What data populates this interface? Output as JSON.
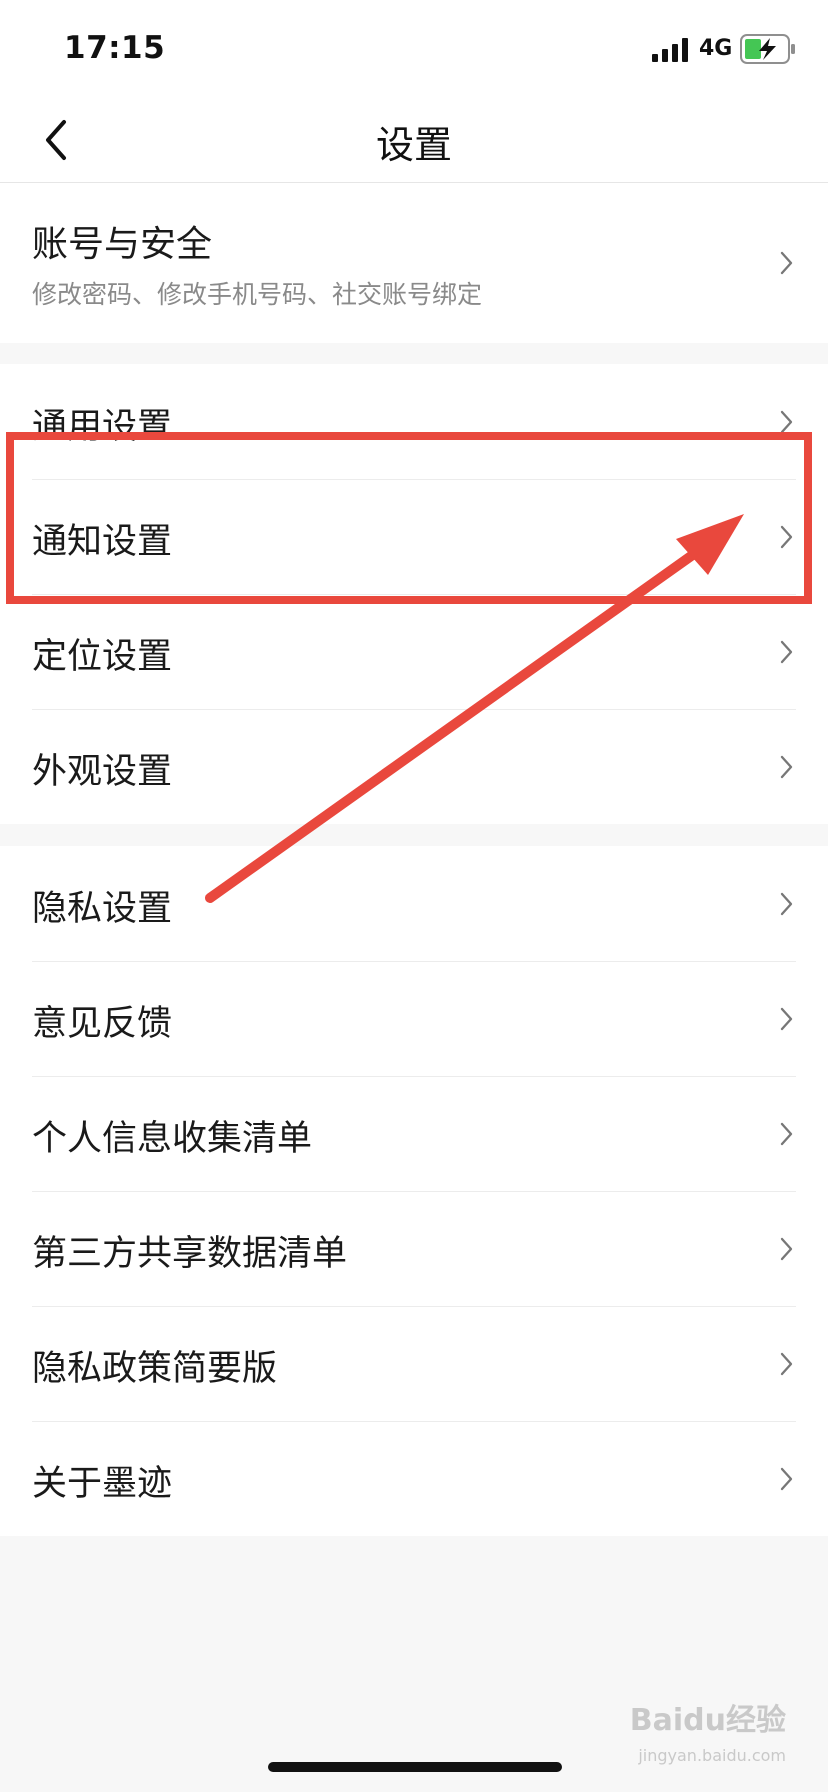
{
  "status_bar": {
    "time": "17:15",
    "network": "4G"
  },
  "nav": {
    "title": "设置",
    "back_icon": "chevron-left-icon"
  },
  "account": {
    "title": "账号与安全",
    "subtitle": "修改密码、修改手机号码、社交账号绑定"
  },
  "settings_group": {
    "items": [
      {
        "label": "通用设置"
      },
      {
        "label": "通知设置"
      },
      {
        "label": "定位设置"
      },
      {
        "label": "外观设置"
      }
    ]
  },
  "info_group": {
    "items": [
      {
        "label": "隐私设置"
      },
      {
        "label": "意见反馈"
      },
      {
        "label": "个人信息收集清单"
      },
      {
        "label": "第三方共享数据清单"
      },
      {
        "label": "隐私政策简要版"
      },
      {
        "label": "关于墨迹"
      }
    ]
  },
  "watermark": {
    "brand": "Baidu经验",
    "url": "jingyan.baidu.com"
  },
  "colors": {
    "annotation": "#e9483d",
    "background": "#f7f7f7",
    "surface": "#ffffff",
    "text": "#1a1a1a",
    "secondary_text": "#8a8a8a",
    "battery": "#44c654"
  },
  "icons": {
    "row_chevron": "chevron-right-icon",
    "signal": "signal-icon",
    "battery": "battery-charging-icon"
  }
}
